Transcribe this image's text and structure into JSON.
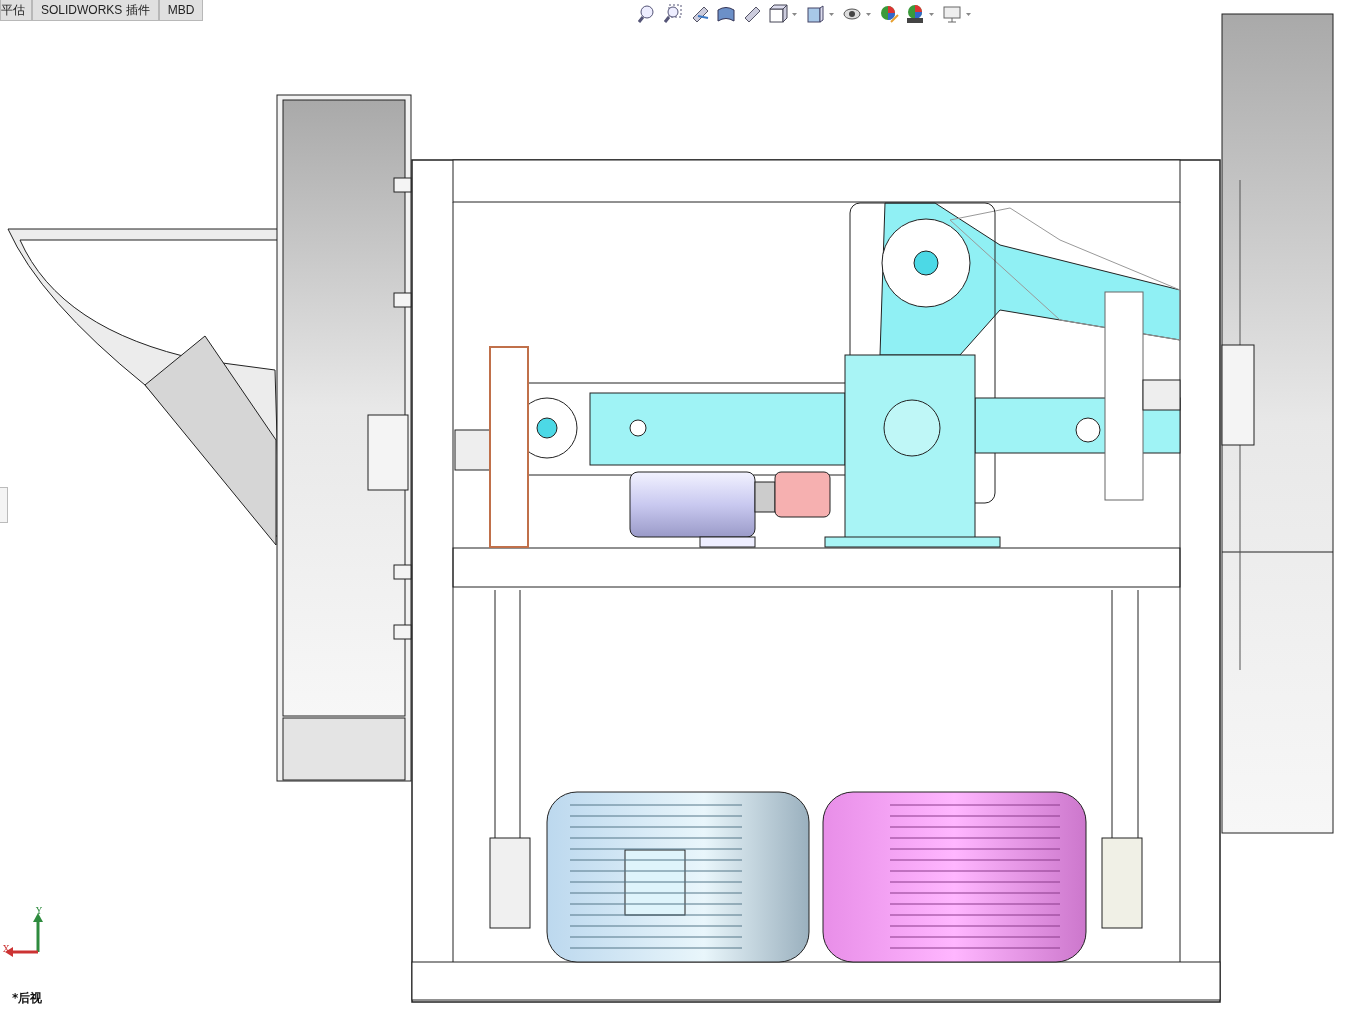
{
  "tabs": [
    {
      "label": "平估",
      "selected": false
    },
    {
      "label": "SOLIDWORKS 插件",
      "selected": false
    },
    {
      "label": "MBD",
      "selected": false
    }
  ],
  "triad": {
    "x_label": "X",
    "y_label": "Y"
  },
  "view_label": "*后视"
}
